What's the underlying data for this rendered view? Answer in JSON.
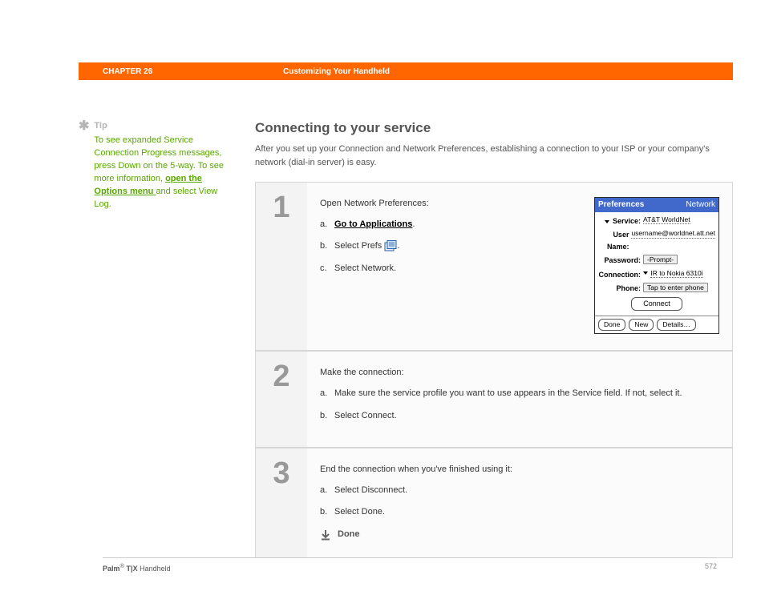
{
  "header": {
    "chapter": "CHAPTER 26",
    "title": "Customizing Your Handheld"
  },
  "tip": {
    "label": "Tip",
    "text_before": "To see expanded Service Connection Progress messages, press Down on the 5-way. To see more information, ",
    "link": "open the Options menu ",
    "text_after": "and select View Log."
  },
  "section": {
    "title": "Connecting to your service",
    "intro": "After you set up your Connection and Network Preferences, establishing a connection to your ISP or your company's network (dial-in server) is easy."
  },
  "steps": [
    {
      "num": "1",
      "lead": "Open Network Preferences:",
      "items": [
        {
          "lbl": "a.",
          "link": "Go to Applications",
          "suffix": "."
        },
        {
          "lbl": "b.",
          "text_before": "Select Prefs ",
          "icon": true,
          "text_after": "."
        },
        {
          "lbl": "c.",
          "text": "Select Network."
        }
      ]
    },
    {
      "num": "2",
      "lead": "Make the connection:",
      "items": [
        {
          "lbl": "a.",
          "text": "Make sure the service profile you want to use appears in the Service field. If not, select it."
        },
        {
          "lbl": "b.",
          "text": "Select Connect."
        }
      ]
    },
    {
      "num": "3",
      "lead": "End the connection when you've finished using it:",
      "items": [
        {
          "lbl": "a.",
          "text": "Select Disconnect."
        },
        {
          "lbl": "b.",
          "text": "Select Done."
        }
      ],
      "done": "Done"
    }
  ],
  "device": {
    "title": "Preferences",
    "category": "Network",
    "rows": {
      "service_lbl": "Service:",
      "service_val": "AT&T WorldNet",
      "user_lbl": "User Name:",
      "user_val": "username@worldnet.att.net",
      "pass_lbl": "Password:",
      "pass_val": "-Prompt-",
      "conn_lbl": "Connection:",
      "conn_val": "IR to Nokia 6310i",
      "phone_lbl": "Phone:",
      "phone_val": "Tap to enter phone"
    },
    "connect_btn": "Connect",
    "footer": {
      "done": "Done",
      "new": "New",
      "details": "Details…"
    }
  },
  "footer": {
    "brand_bold": "Palm",
    "brand_reg": "®",
    "brand_model": " T|X",
    "brand_suffix": " Handheld",
    "page": "572"
  }
}
